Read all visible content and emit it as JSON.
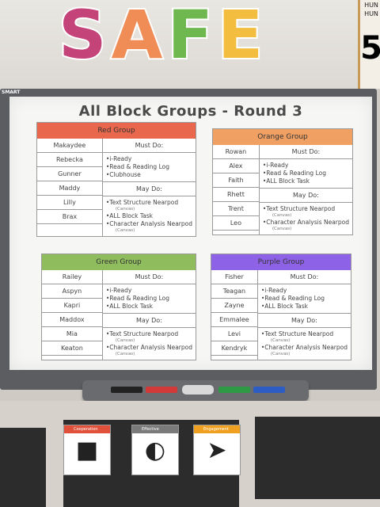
{
  "wall": {
    "banner_letters": [
      "S",
      "A",
      "F",
      "E"
    ],
    "banner_colors": [
      "#c4447a",
      "#f08c55",
      "#6fb84f",
      "#f3bd3f"
    ],
    "number_chart_label": "HUN",
    "number_chart_sublabel": "HUN",
    "number_chart_value": "5"
  },
  "board": {
    "brand": "SMART",
    "title": "All Block Groups - Round 3",
    "groups": [
      {
        "name": "Red Group",
        "color": "#e8674d",
        "students": [
          "Makaydee",
          "Rebecka",
          "Gunner",
          "Maddy",
          "Lilly",
          "Brax"
        ],
        "must_label": "Must Do:",
        "must": [
          {
            "t": "i-Ready",
            "s": ""
          },
          {
            "t": "Read & Reading Log",
            "s": ""
          },
          {
            "t": "Clubhouse",
            "s": ""
          }
        ],
        "may_label": "May Do:",
        "may": [
          {
            "t": "Text Structure Nearpod",
            "s": "(Canvas)"
          },
          {
            "t": "ALL Block Task",
            "s": ""
          },
          {
            "t": "Character Analysis Nearpod",
            "s": "(Canvas)"
          }
        ]
      },
      {
        "name": "Orange Group",
        "color": "#f0a063",
        "students": [
          "Rowan",
          "Alex",
          "Faith",
          "Rhett",
          "Trent",
          "Leo"
        ],
        "must_label": "Must Do:",
        "must": [
          {
            "t": "i-Ready",
            "s": ""
          },
          {
            "t": "Read & Reading Log",
            "s": ""
          },
          {
            "t": "ALL Block Task",
            "s": ""
          }
        ],
        "may_label": "May Do:",
        "may": [
          {
            "t": "Text Structure Nearpod",
            "s": "(Canvas)"
          },
          {
            "t": "Character Analysis Nearpod",
            "s": "(Canvas)"
          }
        ]
      },
      {
        "name": "Green Group",
        "color": "#8fbd5e",
        "students": [
          "Railey",
          "Aspyn",
          "Kapri",
          "Maddox",
          "Mia",
          "Keaton"
        ],
        "must_label": "Must Do:",
        "must": [
          {
            "t": "i-Ready",
            "s": ""
          },
          {
            "t": "Read & Reading Log",
            "s": ""
          },
          {
            "t": "ALL Block Task",
            "s": ""
          }
        ],
        "may_label": "May Do:",
        "may": [
          {
            "t": "Text Structure Nearpod",
            "s": "(Canvas)"
          },
          {
            "t": "Character Analysis Nearpod",
            "s": "(Canvas)"
          }
        ]
      },
      {
        "name": "Purple Group",
        "color": "#8d62e6",
        "students": [
          "Fisher",
          "Teagan",
          "Zayne",
          "Emmalee",
          "Levi",
          "Kendryk"
        ],
        "must_label": "Must Do:",
        "must": [
          {
            "t": "i-Ready",
            "s": ""
          },
          {
            "t": "Read & Reading Log",
            "s": ""
          },
          {
            "t": "ALL Block Task",
            "s": ""
          }
        ],
        "may_label": "May Do:",
        "may": [
          {
            "t": "Text Structure Nearpod",
            "s": "(Canvas)"
          },
          {
            "t": "Character Analysis Nearpod",
            "s": "(Canvas)"
          }
        ]
      }
    ]
  },
  "tray": {
    "pen_colors": [
      "#222222",
      "#d23a3a",
      "#2f9a45",
      "#2d5cc4"
    ]
  },
  "posters": [
    {
      "label": "Cooperation",
      "color": "#e0503a",
      "icon": "people-icon",
      "glyph": "■"
    },
    {
      "label": "Effective Listening",
      "color": "#7a7a7a",
      "icon": "ear-icon",
      "glyph": "◐"
    },
    {
      "label": "Engagement",
      "color": "#f0a020",
      "icon": "rocket-icon",
      "glyph": "➤"
    }
  ]
}
